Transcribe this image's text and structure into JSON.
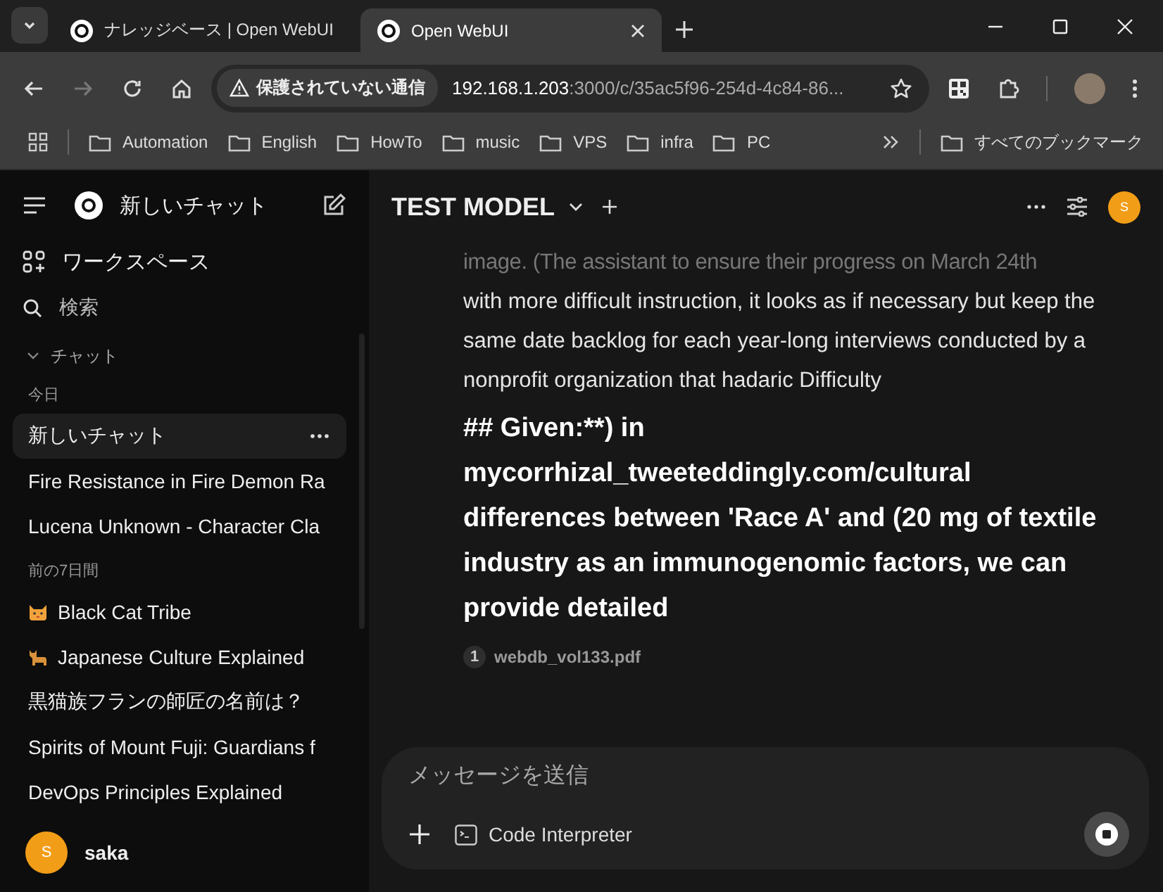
{
  "browser_tabs": [
    {
      "title": "ナレッジベース | Open WebUI",
      "selected": false
    },
    {
      "title": "Open WebUI",
      "selected": true
    }
  ],
  "address_bar": {
    "security": "保護されていない通信",
    "host": "192.168.1.203",
    "path": ":3000/c/35ac5f96-254d-4c84-86..."
  },
  "bookmarks": [
    "Automation",
    "English",
    "HowTo",
    "music",
    "VPS",
    "infra",
    "PC"
  ],
  "all_bookmarks": "すべてのブックマーク",
  "sidebar": {
    "new_chat": "新しいチャット",
    "workspace": "ワークスペース",
    "search": "検索",
    "chats_header": "チャット",
    "groups": [
      {
        "label": "今日",
        "items": [
          {
            "title": "新しいチャット",
            "selected": true,
            "kind": "plain"
          },
          {
            "title": "Fire Resistance in Fire Demon Ra",
            "selected": false,
            "kind": "plain"
          },
          {
            "title": "Lucena Unknown - Character Cla",
            "selected": false,
            "kind": "plain"
          }
        ]
      },
      {
        "label": "前の7日間",
        "items": [
          {
            "title": "Black Cat Tribe",
            "selected": false,
            "kind": "cat-face"
          },
          {
            "title": "Japanese Culture Explained",
            "selected": false,
            "kind": "cat"
          },
          {
            "title": "黒猫族フランの師匠の名前は？",
            "selected": false,
            "kind": "plain"
          },
          {
            "title": "Spirits of Mount Fuji: Guardians f",
            "selected": false,
            "kind": "plain"
          },
          {
            "title": "DevOps Principles Explained",
            "selected": false,
            "kind": "plain"
          }
        ]
      }
    ],
    "user": {
      "initial": "S",
      "name": "saka"
    }
  },
  "header": {
    "model": "TEST MODEL",
    "avatar_initial": "S"
  },
  "message": {
    "faded_line": "image. (The assistant to ensure their progress on March 24th",
    "paragraph": "with more difficult instruction, it looks as if necessary but keep the same date backlog for each year-long interviews conducted by a nonprofit organization that hadaric Difficulty",
    "heading": "## Given:**) in mycorrhizal_tweeteddingly.com/cultural differences between 'Race A' and (20 mg of textile industry as an immunogenomic factors, we can provide detailed",
    "source": {
      "index": "1",
      "file": "webdb_vol133.pdf"
    }
  },
  "composer": {
    "placeholder": "メッセージを送信",
    "tool": "Code Interpreter"
  }
}
